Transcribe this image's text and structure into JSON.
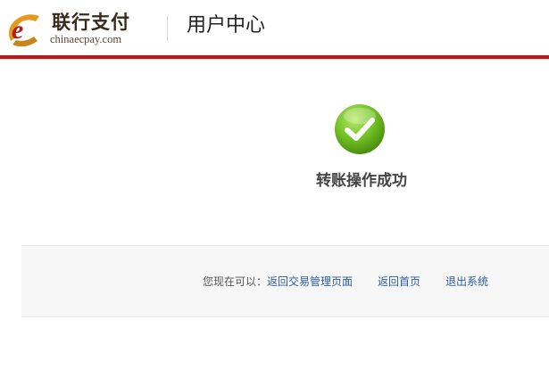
{
  "header": {
    "logo": {
      "brand_name": "联行支付",
      "url_text": "chinaecpay.com"
    },
    "title": "用户中心"
  },
  "colors": {
    "accent_red": "#b01c1c",
    "logo_orange": "#e39a1c",
    "success_green": "#6fbf1f",
    "link_blue": "#2a5d9f"
  },
  "result": {
    "icon": "check-circle-icon",
    "message": "转账操作成功"
  },
  "links": {
    "prompt": "您现在可以：",
    "items": [
      {
        "label": "返回交易管理页面"
      },
      {
        "label": "返回首页"
      },
      {
        "label": "退出系统"
      }
    ]
  }
}
